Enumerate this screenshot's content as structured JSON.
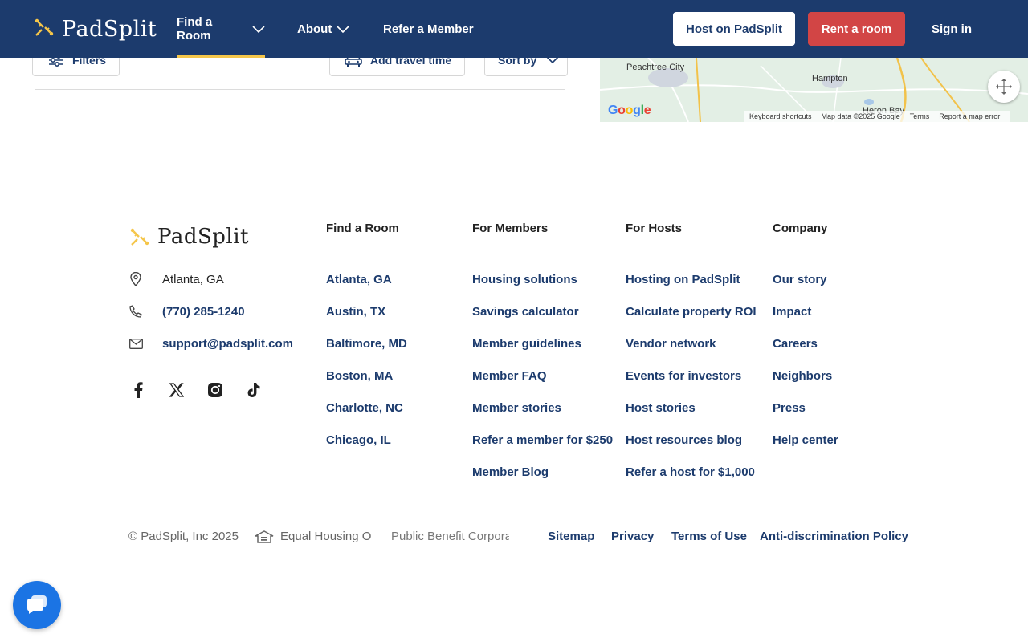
{
  "header": {
    "logo_text": "PadSplit",
    "nav": [
      {
        "label": "Find a Room"
      },
      {
        "label": "About"
      },
      {
        "label": "Refer a Member"
      }
    ],
    "host_button": "Host on PadSplit",
    "rent_button": "Rent a room",
    "signin": "Sign in"
  },
  "toolbar": {
    "filters": "Filters",
    "travel": "Add travel time",
    "sort": "Sort by"
  },
  "map": {
    "labels": [
      "Peachtree City",
      "Hampton",
      "Heron Bay"
    ],
    "google": "Google",
    "footer": [
      "Keyboard shortcuts",
      "Map data ©2025 Google",
      "Terms",
      "Report a map error"
    ]
  },
  "footer": {
    "logo_text": "PadSplit",
    "location": "Atlanta, GA",
    "phone": "(770) 285-1240",
    "email": "support@padsplit.com",
    "social": [
      "facebook-icon",
      "x-icon",
      "instagram-icon",
      "tiktok-icon"
    ],
    "columns": [
      {
        "title": "Find a Room",
        "links": [
          "Atlanta, GA",
          "Austin, TX",
          "Baltimore, MD",
          "Boston, MA",
          "Charlotte, NC",
          "Chicago, IL"
        ]
      },
      {
        "title": "For Members",
        "links": [
          "Housing solutions",
          "Savings calculator",
          "Member guidelines",
          "Member FAQ",
          "Member stories",
          "Refer a member for $250",
          "Member Blog"
        ]
      },
      {
        "title": "For Hosts",
        "links": [
          "Hosting on PadSplit",
          "Calculate property ROI",
          "Vendor network",
          "Events for investors",
          "Host stories",
          "Host resources blog",
          "Refer a host for $1,000"
        ]
      },
      {
        "title": "Company",
        "links": [
          "Our story",
          "Impact",
          "Careers",
          "Neighbors",
          "Press",
          "Help center"
        ]
      }
    ],
    "bottom": {
      "copyright": "© PadSplit, Inc 2025",
      "equal_housing": "Equal Housing Opportunity",
      "public_benefit": "Public Benefit Corporation",
      "links": [
        "Sitemap",
        "Privacy",
        "Terms of Use",
        "Anti-discrimination Policy"
      ]
    }
  },
  "colors": {
    "header_bg": "#1c3b6d",
    "accent_yellow": "#f5c64a",
    "rent_red": "#d24545",
    "link_blue": "#1c3b6d",
    "chat_blue": "#1b74e4"
  }
}
